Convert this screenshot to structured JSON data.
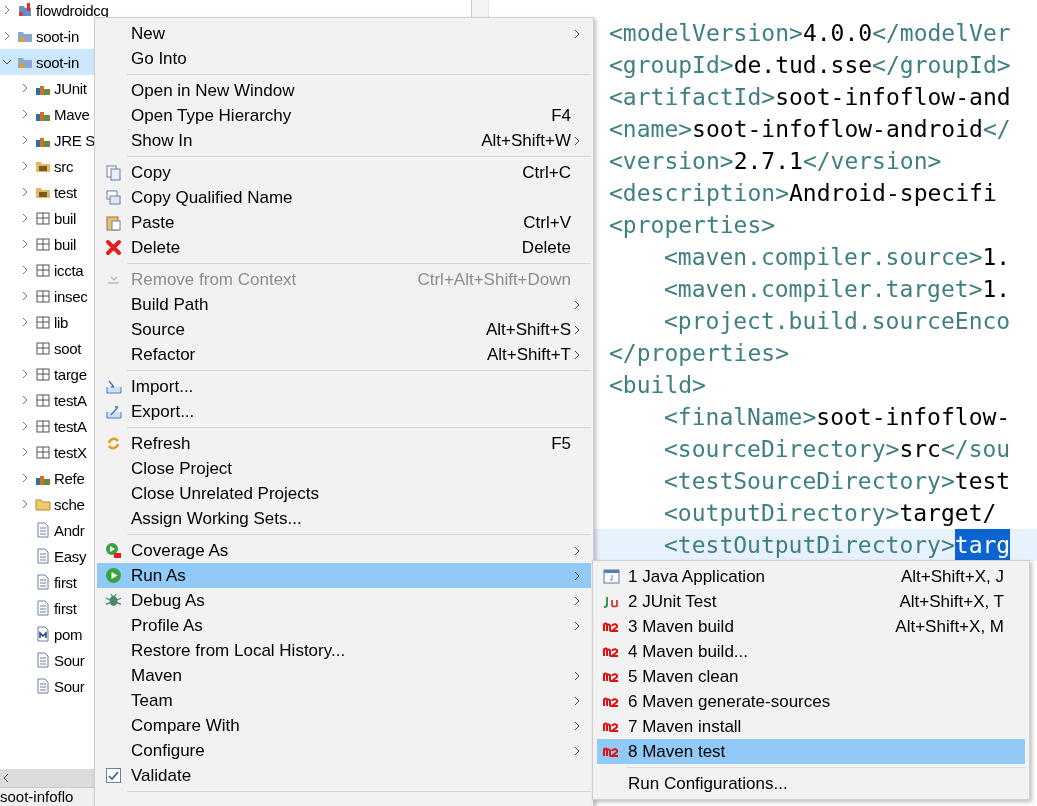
{
  "tree": [
    {
      "label": "flowdroidcg",
      "kind": "project-error",
      "expanded": false,
      "selected": false
    },
    {
      "label": "soot-in",
      "kind": "project",
      "expanded": false,
      "selected": false
    },
    {
      "label": "soot-in",
      "kind": "project",
      "expanded": true,
      "selected": true,
      "children": [
        {
          "label": "JUnit",
          "kind": "library",
          "expanded": false,
          "selected": false
        },
        {
          "label": "Mave",
          "kind": "library",
          "expanded": false,
          "selected": false
        },
        {
          "label": "JRE S",
          "kind": "library",
          "expanded": false,
          "selected": false
        },
        {
          "label": "src",
          "kind": "source-folder",
          "expanded": false,
          "selected": false
        },
        {
          "label": "test",
          "kind": "source-folder",
          "expanded": false,
          "selected": false
        },
        {
          "label": "buil",
          "kind": "package",
          "expanded": false,
          "selected": false
        },
        {
          "label": "buil",
          "kind": "package",
          "expanded": false,
          "selected": false
        },
        {
          "label": "iccta",
          "kind": "package",
          "expanded": false,
          "selected": false
        },
        {
          "label": "insec",
          "kind": "package",
          "expanded": false,
          "selected": false
        },
        {
          "label": "lib",
          "kind": "package",
          "expanded": false,
          "selected": false
        },
        {
          "label": "soot",
          "kind": "package-leaf",
          "expanded": false,
          "selected": false
        },
        {
          "label": "targe",
          "kind": "package",
          "expanded": false,
          "selected": false
        },
        {
          "label": "testA",
          "kind": "package",
          "expanded": false,
          "selected": false
        },
        {
          "label": "testA",
          "kind": "package",
          "expanded": false,
          "selected": false
        },
        {
          "label": "testX",
          "kind": "package",
          "expanded": false,
          "selected": false
        },
        {
          "label": "Refe",
          "kind": "library",
          "expanded": false,
          "selected": false
        },
        {
          "label": "sche",
          "kind": "folder",
          "expanded": false,
          "selected": false
        },
        {
          "label": "Andr",
          "kind": "file",
          "expanded": false,
          "selected": false
        },
        {
          "label": "Easy",
          "kind": "file",
          "expanded": false,
          "selected": false
        },
        {
          "label": "first",
          "kind": "file",
          "expanded": false,
          "selected": false
        },
        {
          "label": "first",
          "kind": "file",
          "expanded": false,
          "selected": false
        },
        {
          "label": "pom",
          "kind": "maven-file",
          "expanded": false,
          "selected": false
        },
        {
          "label": "Sour",
          "kind": "file",
          "expanded": false,
          "selected": false
        },
        {
          "label": "Sour",
          "kind": "file",
          "expanded": false,
          "selected": false
        }
      ]
    }
  ],
  "bottom_tab": {
    "label": "soot-infoflo"
  },
  "editor": {
    "lines": [
      {
        "indented": false,
        "current": false,
        "segments": [
          {
            "kind": "tag",
            "text": "<modelVersion>"
          },
          {
            "kind": "text",
            "text": "4.0.0"
          },
          {
            "kind": "tag",
            "text": "</modelVer"
          }
        ]
      },
      {
        "indented": false,
        "current": false,
        "segments": [
          {
            "kind": "tag",
            "text": "<groupId>"
          },
          {
            "kind": "text",
            "text": "de.tud.sse"
          },
          {
            "kind": "tag",
            "text": "</groupId>"
          }
        ]
      },
      {
        "indented": false,
        "current": false,
        "segments": [
          {
            "kind": "tag",
            "text": "<artifactId>"
          },
          {
            "kind": "text",
            "text": "soot-infoflow-and"
          }
        ]
      },
      {
        "indented": false,
        "current": false,
        "segments": [
          {
            "kind": "tag",
            "text": "<name>"
          },
          {
            "kind": "text",
            "text": "soot-infoflow-android"
          },
          {
            "kind": "tag",
            "text": "</"
          }
        ]
      },
      {
        "indented": false,
        "current": false,
        "segments": [
          {
            "kind": "tag",
            "text": "<version>"
          },
          {
            "kind": "text",
            "text": "2.7.1"
          },
          {
            "kind": "tag",
            "text": "</version>"
          }
        ]
      },
      {
        "indented": false,
        "current": false,
        "segments": [
          {
            "kind": "tag",
            "text": "<description>"
          },
          {
            "kind": "text",
            "text": "Android-specifi"
          }
        ]
      },
      {
        "indented": false,
        "current": false,
        "segments": [
          {
            "kind": "tag",
            "text": "<properties>"
          }
        ]
      },
      {
        "indented": true,
        "current": false,
        "segments": [
          {
            "kind": "tag",
            "text": "<maven.compiler.source>"
          },
          {
            "kind": "text",
            "text": "1."
          }
        ]
      },
      {
        "indented": true,
        "current": false,
        "segments": [
          {
            "kind": "tag",
            "text": "<maven.compiler.target>"
          },
          {
            "kind": "text",
            "text": "1."
          }
        ]
      },
      {
        "indented": true,
        "current": false,
        "segments": [
          {
            "kind": "tag",
            "text": "<project.build.sourceEnco"
          }
        ]
      },
      {
        "indented": false,
        "current": false,
        "segments": [
          {
            "kind": "tag",
            "text": "</properties>"
          }
        ]
      },
      {
        "indented": false,
        "current": false,
        "segments": [
          {
            "kind": "tag",
            "text": "<build>"
          }
        ]
      },
      {
        "indented": true,
        "current": false,
        "segments": [
          {
            "kind": "tag",
            "text": "<finalName>"
          },
          {
            "kind": "text",
            "text": "soot-infoflow-"
          }
        ]
      },
      {
        "indented": true,
        "current": false,
        "segments": [
          {
            "kind": "tag",
            "text": "<sourceDirectory>"
          },
          {
            "kind": "text",
            "text": "src"
          },
          {
            "kind": "tag",
            "text": "</sou"
          }
        ]
      },
      {
        "indented": true,
        "current": false,
        "segments": [
          {
            "kind": "tag",
            "text": "<testSourceDirectory>"
          },
          {
            "kind": "text",
            "text": "test"
          }
        ]
      },
      {
        "indented": true,
        "current": false,
        "segments": [
          {
            "kind": "tag",
            "text": "<outputDirectory>"
          },
          {
            "kind": "text",
            "text": "target/"
          }
        ]
      },
      {
        "indented": true,
        "current": true,
        "segments": [
          {
            "kind": "tag",
            "text": "<testOutputDirectory>"
          },
          {
            "kind": "selection",
            "text": "targ"
          }
        ]
      }
    ]
  },
  "context_menu": {
    "more_below": true,
    "groups": [
      [
        {
          "label": "New",
          "submenu": true,
          "kind": "plain",
          "disabled": false,
          "selected": false
        },
        {
          "label": "Go Into",
          "submenu": false,
          "kind": "plain",
          "disabled": false,
          "selected": false
        }
      ],
      [
        {
          "label": "Open in New Window",
          "submenu": false,
          "kind": "plain",
          "disabled": false,
          "selected": false
        },
        {
          "label": "Open Type Hierarchy",
          "shortcut": "F4",
          "submenu": false,
          "kind": "plain",
          "disabled": false,
          "selected": false
        },
        {
          "label": "Show In",
          "shortcut": "Alt+Shift+W",
          "submenu": true,
          "kind": "plain",
          "disabled": false,
          "selected": false
        }
      ],
      [
        {
          "label": "Copy",
          "shortcut": "Ctrl+C",
          "submenu": false,
          "kind": "copy",
          "disabled": false,
          "selected": false
        },
        {
          "label": "Copy Qualified Name",
          "submenu": false,
          "kind": "copy-name",
          "disabled": false,
          "selected": false
        },
        {
          "label": "Paste",
          "shortcut": "Ctrl+V",
          "submenu": false,
          "kind": "paste",
          "disabled": false,
          "selected": false
        },
        {
          "label": "Delete",
          "shortcut": "Delete",
          "submenu": false,
          "kind": "delete",
          "disabled": false,
          "selected": false
        }
      ],
      [
        {
          "label": "Remove from Context",
          "shortcut": "Ctrl+Alt+Shift+Down",
          "submenu": false,
          "kind": "remove",
          "disabled": true,
          "selected": false
        },
        {
          "label": "Build Path",
          "submenu": true,
          "kind": "plain",
          "disabled": false,
          "selected": false
        },
        {
          "label": "Source",
          "shortcut": "Alt+Shift+S",
          "submenu": true,
          "kind": "plain",
          "disabled": false,
          "selected": false
        },
        {
          "label": "Refactor",
          "shortcut": "Alt+Shift+T",
          "submenu": true,
          "kind": "plain",
          "disabled": false,
          "selected": false
        }
      ],
      [
        {
          "label": "Import...",
          "submenu": false,
          "kind": "import",
          "disabled": false,
          "selected": false
        },
        {
          "label": "Export...",
          "submenu": false,
          "kind": "export",
          "disabled": false,
          "selected": false
        }
      ],
      [
        {
          "label": "Refresh",
          "shortcut": "F5",
          "submenu": false,
          "kind": "refresh",
          "disabled": false,
          "selected": false
        },
        {
          "label": "Close Project",
          "submenu": false,
          "kind": "plain",
          "disabled": false,
          "selected": false
        },
        {
          "label": "Close Unrelated Projects",
          "submenu": false,
          "kind": "plain",
          "disabled": false,
          "selected": false
        },
        {
          "label": "Assign Working Sets...",
          "submenu": false,
          "kind": "plain",
          "disabled": false,
          "selected": false
        }
      ],
      [
        {
          "label": "Coverage As",
          "submenu": true,
          "kind": "coverage",
          "disabled": false,
          "selected": false
        },
        {
          "label": "Run As",
          "submenu": true,
          "kind": "run",
          "disabled": false,
          "selected": true
        },
        {
          "label": "Debug As",
          "submenu": true,
          "kind": "debug",
          "disabled": false,
          "selected": false
        },
        {
          "label": "Profile As",
          "submenu": true,
          "kind": "plain",
          "disabled": false,
          "selected": false
        },
        {
          "label": "Restore from Local History...",
          "submenu": false,
          "kind": "plain",
          "disabled": false,
          "selected": false
        },
        {
          "label": "Maven",
          "submenu": true,
          "kind": "plain",
          "disabled": false,
          "selected": false
        },
        {
          "label": "Team",
          "submenu": true,
          "kind": "plain",
          "disabled": false,
          "selected": false
        },
        {
          "label": "Compare With",
          "submenu": true,
          "kind": "plain",
          "disabled": false,
          "selected": false
        },
        {
          "label": "Configure",
          "submenu": true,
          "kind": "plain",
          "disabled": false,
          "selected": false
        },
        {
          "label": "Validate",
          "submenu": false,
          "kind": "checkbox",
          "checked": true,
          "disabled": false,
          "selected": false
        }
      ]
    ]
  },
  "run_as_menu": {
    "groups": [
      [
        {
          "label": "1 Java Application",
          "shortcut": "Alt+Shift+X, J",
          "kind": "java-app",
          "selected": false
        },
        {
          "label": "2 JUnit Test",
          "shortcut": "Alt+Shift+X, T",
          "kind": "junit",
          "selected": false
        },
        {
          "label": "3 Maven build",
          "shortcut": "Alt+Shift+X, M",
          "kind": "maven",
          "selected": false
        },
        {
          "label": "4 Maven build...",
          "kind": "maven",
          "selected": false
        },
        {
          "label": "5 Maven clean",
          "kind": "maven",
          "selected": false
        },
        {
          "label": "6 Maven generate-sources",
          "kind": "maven",
          "selected": false
        },
        {
          "label": "7 Maven install",
          "kind": "maven",
          "selected": false
        },
        {
          "label": "8 Maven test",
          "kind": "maven",
          "selected": true
        }
      ],
      [
        {
          "label": "Run Configurations...",
          "kind": "plain",
          "selected": false
        }
      ]
    ]
  }
}
